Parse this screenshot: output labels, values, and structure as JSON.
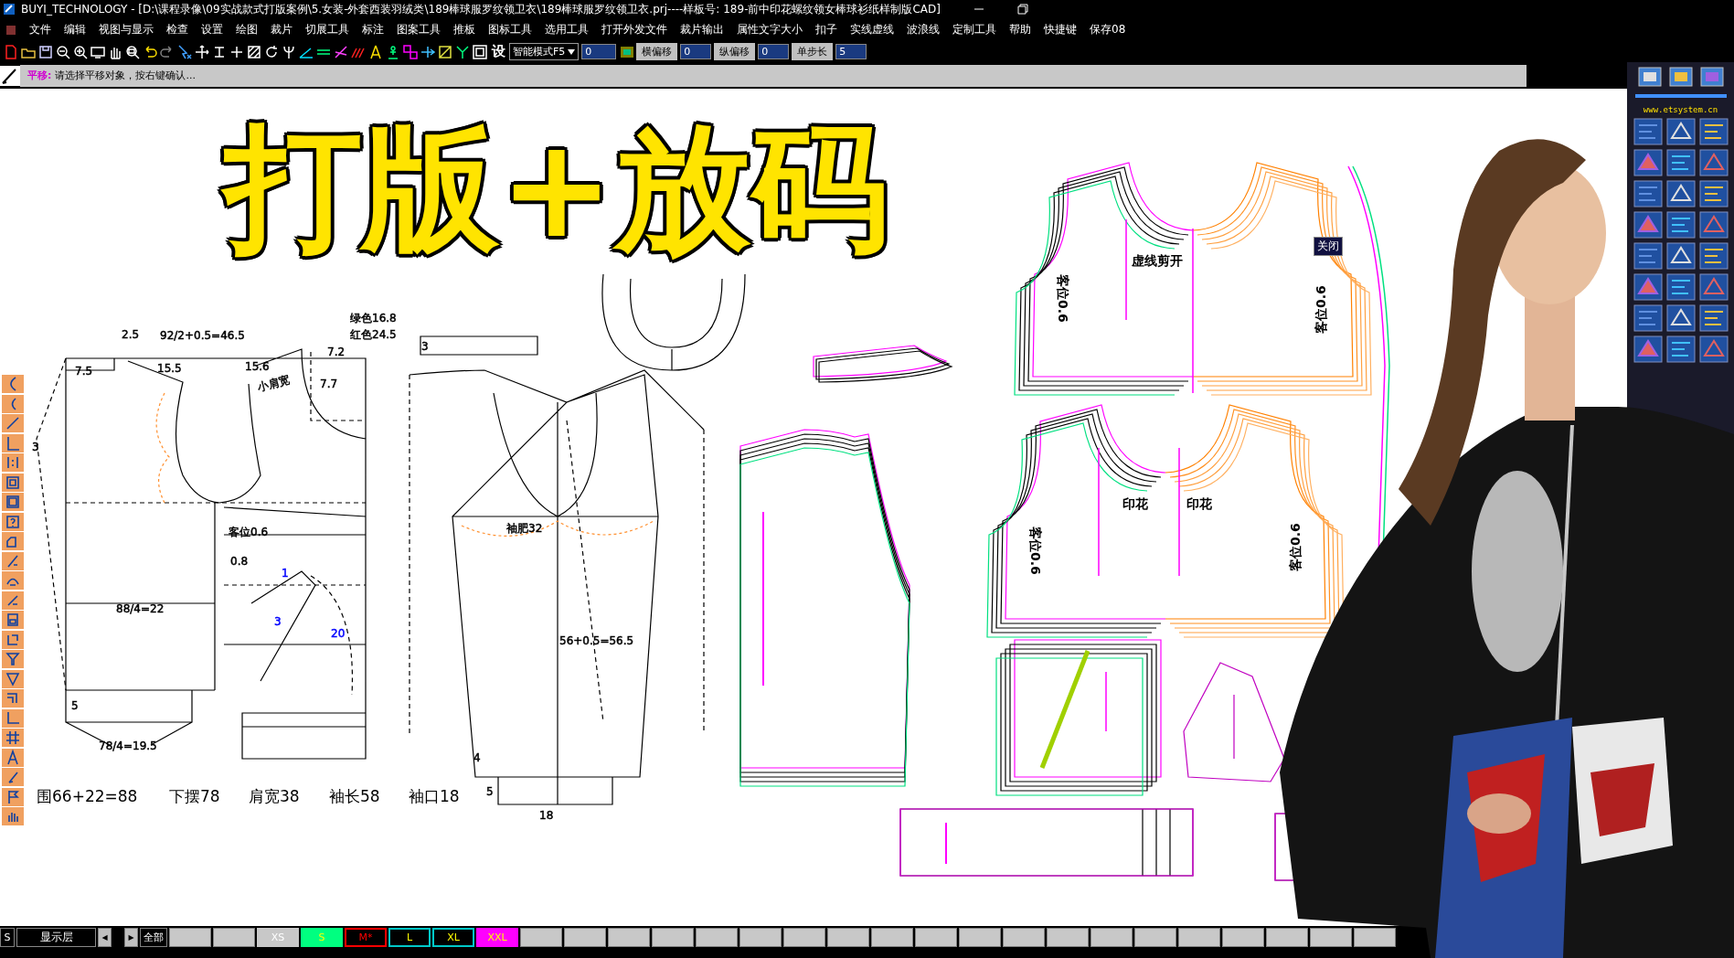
{
  "window": {
    "title": "BUYI_TECHNOLOGY - [D:\\课程录像\\09实战款式打版案例\\5.女装-外套西装羽绒类\\189棒球服罗纹领卫衣\\189棒球服罗纹领卫衣.prj----样板号: 189-前中印花螺纹领女棒球衫纸样制版CAD]"
  },
  "menu": [
    "文件",
    "编辑",
    "视图与显示",
    "检查",
    "设置",
    "绘图",
    "裁片",
    "切展工具",
    "标注",
    "图案工具",
    "推板",
    "图标工具",
    "选用工具",
    "打开外发文件",
    "裁片输出",
    "属性文字大小",
    "扣子",
    "实线虚线",
    "波浪线",
    "定制工具",
    "帮助",
    "快捷键",
    "保存08"
  ],
  "toolbar": {
    "settings_label": "设",
    "mode_dropdown": "智能模式F5",
    "value_field": "0",
    "offset_fields": [
      {
        "label": "横偏移",
        "value": "0"
      },
      {
        "label": "纵偏移",
        "value": "0"
      },
      {
        "label": "单步长",
        "value": "5"
      }
    ]
  },
  "prompt": {
    "command": "平移:",
    "message": "请选择平移对象，按右键确认..."
  },
  "overlay_title": "打版+放码",
  "draft_labels": [
    {
      "text": "2.5",
      "color": "#000000"
    },
    {
      "text": "92/2+0.5=46.5",
      "color": "#000000"
    },
    {
      "text": "绿色16.8",
      "color": "#000000"
    },
    {
      "text": "红色24.5",
      "color": "#000000"
    },
    {
      "text": "7.2",
      "color": "#000000"
    },
    {
      "text": "7.5",
      "color": "#000000"
    },
    {
      "text": "15.5",
      "color": "#000000"
    },
    {
      "text": "15.6",
      "color": "#000000"
    },
    {
      "text": "小肩宽",
      "color": "#000000"
    },
    {
      "text": "7.7",
      "color": "#000000"
    },
    {
      "text": "3",
      "color": "#000000"
    },
    {
      "text": "3",
      "color": "#000000"
    },
    {
      "text": "客位0.6",
      "color": "#000000"
    },
    {
      "text": "0.8",
      "color": "#000000"
    },
    {
      "text": "1",
      "color": "#0000ff"
    },
    {
      "text": "3",
      "color": "#0000ff"
    },
    {
      "text": "20",
      "color": "#0000ff"
    },
    {
      "text": "88/4=22",
      "color": "#000000"
    },
    {
      "text": "5",
      "color": "#000000"
    },
    {
      "text": "78/4=19.5",
      "color": "#000000"
    },
    {
      "text": "袖肥32",
      "color": "#000000"
    },
    {
      "text": "56+0.5=56.5",
      "color": "#000000"
    },
    {
      "text": "4",
      "color": "#000000"
    },
    {
      "text": "5",
      "color": "#000000"
    },
    {
      "text": "18",
      "color": "#000000"
    }
  ],
  "measurement_summary": [
    "围66+22=88",
    "下摆78",
    "肩宽38",
    "袖长58",
    "袖口18"
  ],
  "piece_labels": [
    "虚线剪开",
    "客位0.6",
    "客位0.6",
    "印花",
    "印花",
    "客位0.6",
    "客位0.6"
  ],
  "close_button": "关闭",
  "side_panel": {
    "site": "www.etsystem.cn"
  },
  "status_bar": {
    "layer_button": "S",
    "layer_label": "显示层",
    "prev": "◀",
    "next": "▶",
    "all": "全部",
    "sizes": [
      {
        "label": "XS",
        "kind": "filled",
        "color": "#c8c8c8"
      },
      {
        "label": "S",
        "kind": "filled",
        "color": "#00ff80"
      },
      {
        "label": "M*",
        "kind": "outline",
        "color": "#ff0000"
      },
      {
        "label": "L",
        "kind": "outline",
        "color": "#00c8c8"
      },
      {
        "label": "XL",
        "kind": "outline",
        "color": "#00c8c8"
      },
      {
        "label": "XXL",
        "kind": "filled",
        "color": "#ff00ff"
      }
    ]
  }
}
